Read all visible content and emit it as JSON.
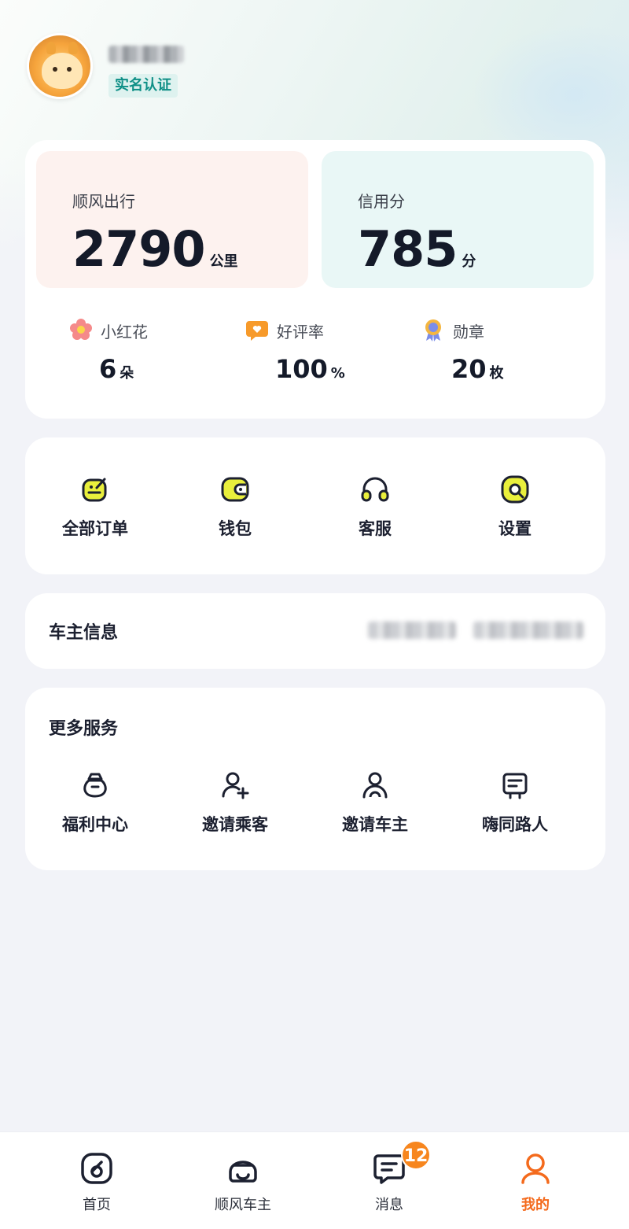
{
  "profile": {
    "verify_badge": "实名认证"
  },
  "stats": {
    "trips": {
      "label": "顺风出行",
      "value": "2790",
      "unit": "公里"
    },
    "credit": {
      "label": "信用分",
      "value": "785",
      "unit": "分"
    },
    "mini": [
      {
        "label": "小红花",
        "value": "6",
        "unit": "朵",
        "icon": "flower-icon",
        "color": "#f26d6d"
      },
      {
        "label": "好评率",
        "value": "100",
        "unit": "%",
        "icon": "heart-bubble-icon",
        "color": "#f79a2a"
      },
      {
        "label": "勋章",
        "value": "20",
        "unit": "枚",
        "icon": "medal-icon",
        "color": "#7b8de8"
      }
    ]
  },
  "actions": [
    {
      "label": "全部订单",
      "icon": "orders-icon"
    },
    {
      "label": "钱包",
      "icon": "wallet-icon"
    },
    {
      "label": "客服",
      "icon": "headset-icon"
    },
    {
      "label": "设置",
      "icon": "settings-icon"
    }
  ],
  "owner": {
    "title": "车主信息"
  },
  "more": {
    "title": "更多服务",
    "items": [
      {
        "label": "福利中心",
        "icon": "gift-bag-icon"
      },
      {
        "label": "邀请乘客",
        "icon": "invite-passenger-icon"
      },
      {
        "label": "邀请车主",
        "icon": "invite-driver-icon"
      },
      {
        "label": "嗨同路人",
        "icon": "chat-board-icon"
      }
    ]
  },
  "tabbar": {
    "items": [
      {
        "label": "首页",
        "icon": "home-icon"
      },
      {
        "label": "顺风车主",
        "icon": "car-icon"
      },
      {
        "label": "消息",
        "icon": "message-icon",
        "badge": "12"
      },
      {
        "label": "我的",
        "icon": "person-icon",
        "active": true
      }
    ],
    "accent": "#f46a1c"
  },
  "colors": {
    "accent_green": "#0e8f86",
    "icon_yellow": "#e9ef3c",
    "badge_orange": "#f7861e"
  }
}
